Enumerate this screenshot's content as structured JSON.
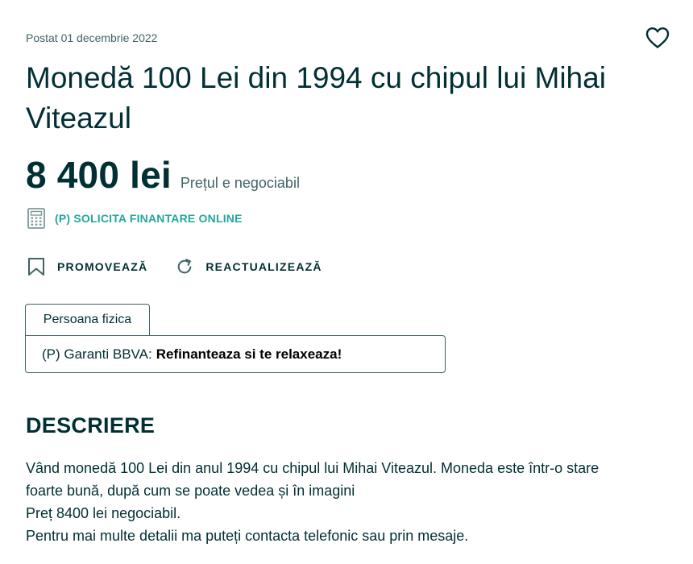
{
  "listing": {
    "posted": "Postat 01 decembrie 2022",
    "title": "Monedă 100 Lei din 1994 cu chipul lui Mihai Viteazul",
    "price": "8 400 lei",
    "negotiable": "Prețul e negociabil"
  },
  "finance": {
    "label": "(P) SOLICITA FINANTARE ONLINE"
  },
  "actions": {
    "promote": "PROMOVEAZĂ",
    "refresh": "REACTUALIZEAZĂ"
  },
  "seller": {
    "type": "Persoana fizica"
  },
  "promo": {
    "prefix": "(P) Garanti BBVA:",
    "highlight": "Refinanteaza si te relaxeaza!"
  },
  "description": {
    "heading": "DESCRIERE",
    "lines": [
      "Vând monedă 100 Lei din anul 1994 cu chipul lui Mihai Viteazul. Moneda este într-o stare",
      "foarte bună, după cum se poate vedea și în imagini",
      "Preț 8400 lei negociabil.",
      "Pentru mai multe detalii ma puteți contacta telefonic sau prin mesaje."
    ]
  },
  "colors": {
    "primary": "#002f34",
    "secondary": "#406367",
    "accent": "#23a69f"
  },
  "icons": {
    "favorite": "heart-icon",
    "finance": "calculator-icon",
    "promote": "bookmark-icon",
    "refresh": "refresh-icon"
  }
}
